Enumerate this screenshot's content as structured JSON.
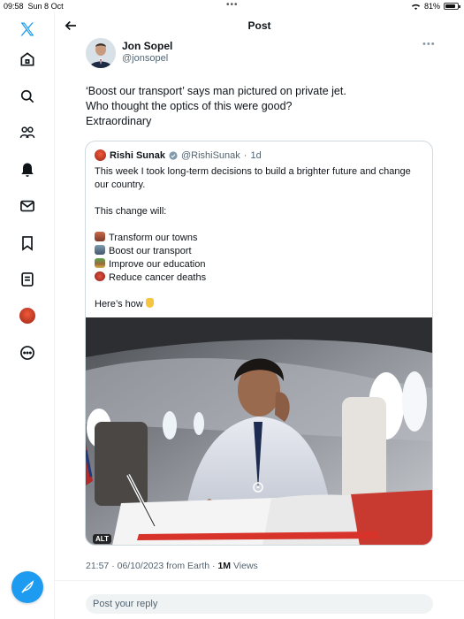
{
  "status_bar": {
    "time": "09:58",
    "date": "Sun 8 Oct",
    "battery": "81%",
    "battery_level": 0.81
  },
  "sidebar": {
    "items": [
      {
        "icon": "x-logo-icon"
      },
      {
        "icon": "home-icon"
      },
      {
        "icon": "search-icon"
      },
      {
        "icon": "communities-icon"
      },
      {
        "icon": "notifications-bell-icon"
      },
      {
        "icon": "messages-icon"
      },
      {
        "icon": "bookmarks-icon"
      },
      {
        "icon": "lists-icon"
      },
      {
        "icon": "profile-avatar"
      },
      {
        "icon": "more-icon"
      }
    ],
    "compose_icon": "compose-feather-icon"
  },
  "header": {
    "title": "Post"
  },
  "tweet": {
    "author_name": "Jon Sopel",
    "author_handle": "@jonsopel",
    "lines": [
      "‘Boost our transport’ says man pictured on private jet.",
      "Who thought the optics of this were good?",
      "Extraordinary"
    ],
    "time": "21:57",
    "date": "06/10/2023",
    "source": "from Earth",
    "views_count": "1M",
    "views_label": "Views"
  },
  "quote": {
    "name": "Rishi Sunak",
    "handle": "@RishiSunak",
    "age": "1d",
    "intro_line1": "This week I took long-term decisions to build a brighter future and change",
    "intro_line2": "our country.",
    "change_line": "This change will:",
    "items": [
      "Transform our towns",
      "Boost our transport",
      "Improve our education",
      "Reduce cancer deaths"
    ],
    "heres_how": "Here’s how",
    "alt_badge": "ALT"
  },
  "reply": {
    "placeholder": "Post your reply"
  },
  "colors": {
    "accent": "#1d9bf0",
    "text": "#0f1419",
    "muted": "#536471",
    "border": "#cfd9de"
  }
}
